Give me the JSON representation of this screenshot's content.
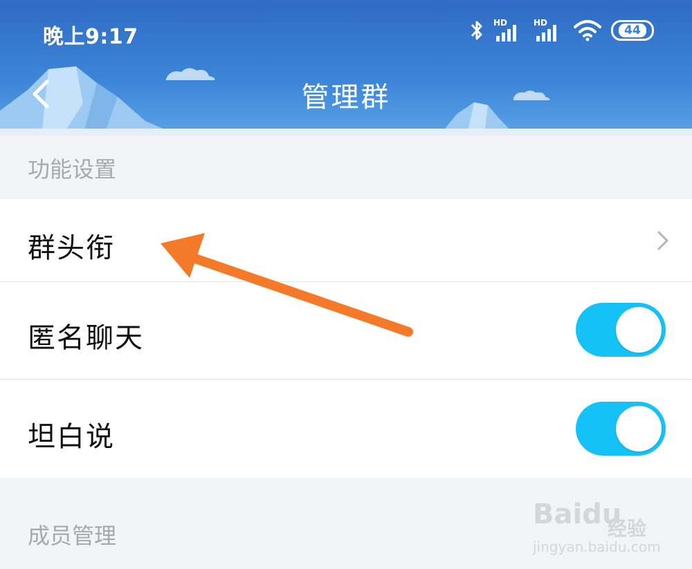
{
  "status_bar": {
    "time": "晚上9:17",
    "hd_label": "HD",
    "battery": "44"
  },
  "header": {
    "title": "管理群"
  },
  "sections": {
    "features_title": "功能设置",
    "members_title": "成员管理"
  },
  "rows": {
    "group_title_label": "群头衔",
    "anonymous_chat_label": "匿名聊天",
    "anonymous_chat_on": true,
    "honest_talk_label": "坦白说",
    "honest_talk_on": true
  },
  "watermark": {
    "main": "Baidu",
    "cn": "经验",
    "sub": "jingyan.baidu.com"
  },
  "colors": {
    "header_blue": "#3c86d8",
    "toggle_on": "#15c2f7",
    "annotation_arrow": "#f47a2a"
  }
}
